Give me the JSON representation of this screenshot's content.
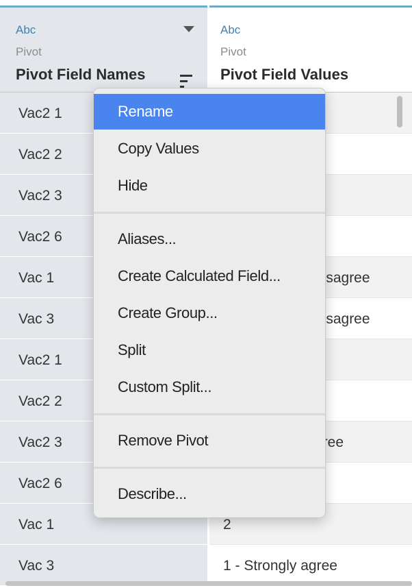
{
  "columns": [
    {
      "type": "Abc",
      "source": "Pivot",
      "name": "Pivot Field Names"
    },
    {
      "type": "Abc",
      "source": "Pivot",
      "name": "Pivot Field Values"
    }
  ],
  "rows": [
    {
      "name": "Vac2 1",
      "value": ""
    },
    {
      "name": "Vac2 2",
      "value": ""
    },
    {
      "name": "Vac2 3",
      "value": ""
    },
    {
      "name": "Vac2 6",
      "value": ""
    },
    {
      "name": "Vac 1",
      "value": "lisagree"
    },
    {
      "name": "Vac 3",
      "value": "lisagree"
    },
    {
      "name": "Vac2 1",
      "value": ""
    },
    {
      "name": "Vac2 2",
      "value": ""
    },
    {
      "name": "Vac2 3",
      "value": "gree"
    },
    {
      "name": "Vac2 6",
      "value": ""
    },
    {
      "name": "Vac 1",
      "value": "2"
    },
    {
      "name": "Vac 3",
      "value": "1 - Strongly agree"
    }
  ],
  "context_menu": {
    "items": [
      "Rename",
      "Copy Values",
      "Hide",
      "Aliases...",
      "Create Calculated Field...",
      "Create Group...",
      "Split",
      "Custom Split...",
      "Remove Pivot",
      "Describe..."
    ],
    "highlighted": "Rename"
  },
  "colors": {
    "accent_top": "#6fa8c9",
    "type_label": "#3f7fb0",
    "highlight": "#4a84ef",
    "name_column_bg": "#e3e7ec"
  },
  "icons": {
    "dropdown": "chevron-down-icon",
    "sort": "sort-icon"
  }
}
